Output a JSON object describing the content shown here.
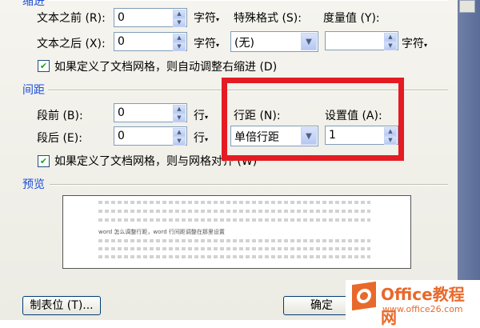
{
  "indent": {
    "section_label": "缩进",
    "before_text_label": "文本之前 (R):",
    "before_text_value": "0",
    "before_text_unit": "字符",
    "after_text_label": "文本之后 (X):",
    "after_text_value": "0",
    "after_text_unit": "字符",
    "special_format_label": "特殊格式 (S):",
    "special_format_value": "(无)",
    "measure_label": "度量值 (Y):",
    "measure_value": "",
    "measure_unit": "字符",
    "auto_adjust_checkbox": "如果定义了文档网格，则自动调整右缩进 (D)",
    "auto_adjust_checked": true
  },
  "spacing": {
    "section_label": "间距",
    "before_label": "段前 (B):",
    "before_value": "0",
    "before_unit": "行",
    "after_label": "段后 (E):",
    "after_value": "0",
    "after_unit": "行",
    "line_spacing_label": "行距 (N):",
    "line_spacing_value": "单倍行距",
    "set_value_label": "设置值 (A):",
    "set_value": "1",
    "grid_checkbox": "如果定义了文档网格，则与网格对齐 (W)",
    "grid_checked": true
  },
  "preview": {
    "section_label": "预览",
    "sample_text": "word 怎么调整行距，word 行间距调整在那里设置"
  },
  "buttons": {
    "tabs": "制表位 (T)...",
    "ok": "确定"
  },
  "watermark": {
    "name": "Office教程网",
    "url": "www.office26.com"
  },
  "colors": {
    "highlight": "#e41b23",
    "section_label": "#1c4ed8",
    "logo": "#e8692a"
  }
}
